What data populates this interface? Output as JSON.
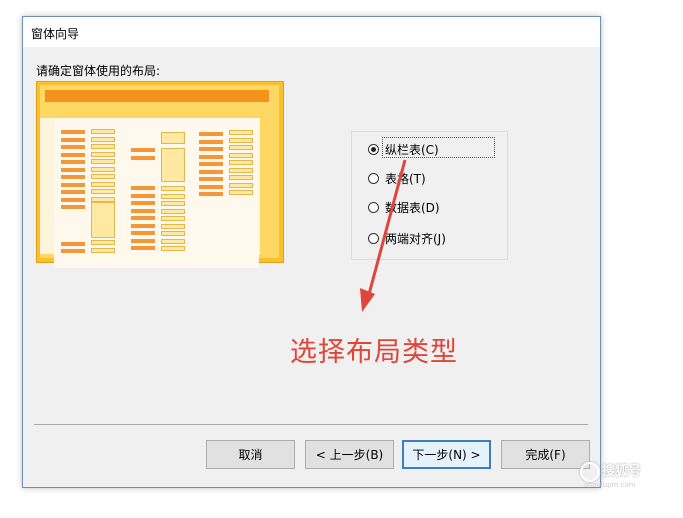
{
  "window": {
    "title": "窗体向导"
  },
  "prompt": "请确定窗体使用的布局:",
  "layout_options": [
    {
      "label": "纵栏表(C)",
      "selected": true
    },
    {
      "label": "表格(T)",
      "selected": false
    },
    {
      "label": "数据表(D)",
      "selected": false
    },
    {
      "label": "两端对齐(J)",
      "selected": false
    }
  ],
  "annotation": "选择布局类型",
  "buttons": {
    "cancel": "取消",
    "back": "< 上一步(B)",
    "next": "下一步(N) >",
    "finish": "完成(F)"
  },
  "watermark": {
    "text": "搜狐号",
    "url": "shoulupm.com"
  },
  "colors": {
    "annotation": "#e0453a",
    "preview_frame": "#fdbf2b",
    "preview_accent": "#f3931c"
  }
}
